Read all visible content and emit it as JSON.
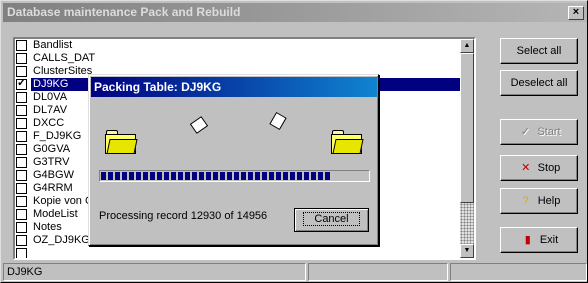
{
  "window": {
    "title": "Database maintenance Pack and Rebuild",
    "close_glyph": "×"
  },
  "list": {
    "items": [
      {
        "label": "Bandlist",
        "checked": false,
        "selected": false
      },
      {
        "label": "CALLS_DAT",
        "checked": false,
        "selected": false
      },
      {
        "label": "ClusterSites",
        "checked": false,
        "selected": false
      },
      {
        "label": "DJ9KG",
        "checked": true,
        "selected": true
      },
      {
        "label": "DL0VA",
        "checked": false,
        "selected": false
      },
      {
        "label": "DL7AV",
        "checked": false,
        "selected": false
      },
      {
        "label": "DXCC",
        "checked": false,
        "selected": false
      },
      {
        "label": "F_DJ9KG",
        "checked": false,
        "selected": false
      },
      {
        "label": "G0GVA",
        "checked": false,
        "selected": false
      },
      {
        "label": "G3TRV",
        "checked": false,
        "selected": false
      },
      {
        "label": "G4BGW",
        "checked": false,
        "selected": false
      },
      {
        "label": "G4RRM",
        "checked": false,
        "selected": false
      },
      {
        "label": "Kopie von G",
        "checked": false,
        "selected": false
      },
      {
        "label": "ModeList",
        "checked": false,
        "selected": false
      },
      {
        "label": "Notes",
        "checked": false,
        "selected": false
      },
      {
        "label": "OZ_DJ9KG",
        "checked": false,
        "selected": false
      },
      {
        "label": "",
        "checked": false,
        "selected": false
      }
    ],
    "scroll_up_glyph": "▲",
    "scroll_down_glyph": "▼"
  },
  "buttons": {
    "select_all": "Select all",
    "deselect_all": "Deselect all",
    "start": "Start",
    "stop": "Stop",
    "help": "Help",
    "exit": "Exit",
    "start_icon": "✓",
    "stop_icon": "✕",
    "help_icon": "?",
    "exit_icon": "▮"
  },
  "status": {
    "text": "DJ9KG"
  },
  "dialog": {
    "title": "Packing Table: DJ9KG",
    "progress_fraction": 0.8645,
    "processing_text": "Processing record 12930 of 14956",
    "cancel_label": "Cancel"
  },
  "colors": {
    "selection": "#000080",
    "progress": "#000080",
    "stop_icon": "#c00000",
    "help_icon": "#d4b000",
    "exit_icon": "#c00000"
  }
}
